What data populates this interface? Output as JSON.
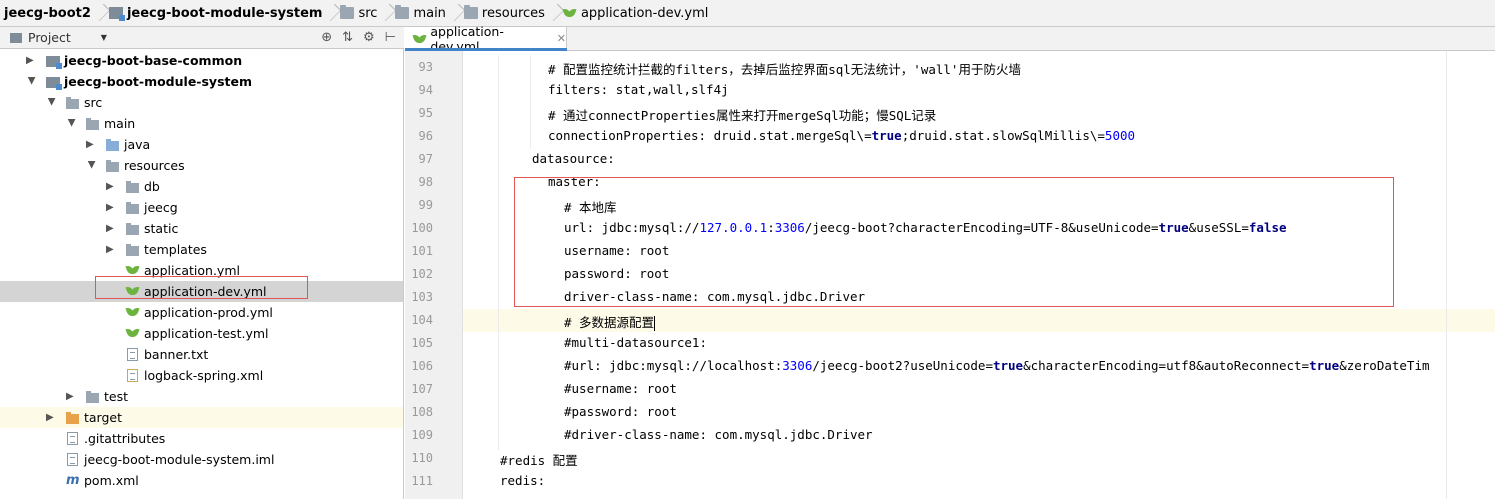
{
  "breadcrumb": [
    "jeecg-boot2",
    "jeecg-boot-module-system",
    "src",
    "main",
    "resources",
    "application-dev.yml"
  ],
  "project_panel": {
    "title": "Project",
    "tree": [
      {
        "label": "jeecg-boot-base-common"
      },
      {
        "label": "jeecg-boot-module-system"
      },
      {
        "label": "src"
      },
      {
        "label": "main"
      },
      {
        "label": "java"
      },
      {
        "label": "resources"
      },
      {
        "label": "db"
      },
      {
        "label": "jeecg"
      },
      {
        "label": "static"
      },
      {
        "label": "templates"
      },
      {
        "label": "application.yml"
      },
      {
        "label": "application-dev.yml"
      },
      {
        "label": "application-prod.yml"
      },
      {
        "label": "application-test.yml"
      },
      {
        "label": "banner.txt"
      },
      {
        "label": "logback-spring.xml"
      },
      {
        "label": "test"
      },
      {
        "label": "target"
      },
      {
        "label": ".gitattributes"
      },
      {
        "label": "jeecg-boot-module-system.iml"
      },
      {
        "label": "pom.xml"
      }
    ]
  },
  "editor": {
    "tab_label": "application-dev.yml",
    "line_numbers": [
      "93",
      "94",
      "95",
      "96",
      "97",
      "98",
      "99",
      "100",
      "101",
      "102",
      "103",
      "104",
      "105",
      "106",
      "107",
      "108",
      "109",
      "110",
      "111"
    ],
    "lines": {
      "l93": "# 配置监控统计拦截的filters，去掉后监控界面sql无法统计，'wall'用于防火墙",
      "l94": "filters: stat,wall,slf4j",
      "l95": "# 通过connectProperties属性来打开mergeSql功能；慢SQL记录",
      "l96a": "connectionProperties: druid.stat.mergeSql\\=",
      "l96b": "true",
      "l96c": ";druid.stat.slowSqlMillis\\=",
      "l96d": "5000",
      "l97": "datasource:",
      "l98": "master:",
      "l99": "# 本地库",
      "l100a": "url: jdbc:mysql://",
      "l100b": "127.0.0.1",
      "l100c": ":",
      "l100d": "3306",
      "l100e": "/jeecg-boot?characterEncoding=UTF-8&useUnicode=",
      "l100f": "true",
      "l100g": "&useSSL=",
      "l100h": "false",
      "l101": "username: root",
      "l102": "password: root",
      "l103": "driver-class-name: com.mysql.jdbc.Driver",
      "l104": "# 多数据源配置",
      "l105": "#multi-datasource1:",
      "l106a": "#url: jdbc:mysql://localhost:",
      "l106b": "3306",
      "l106c": "/jeecg-boot2?useUnicode=",
      "l106d": "true",
      "l106e": "&characterEncoding=utf8&autoReconnect=",
      "l106f": "true",
      "l106g": "&zeroDateTim",
      "l107": "#username: root",
      "l108": "#password: root",
      "l109": "#driver-class-name: com.mysql.jdbc.Driver",
      "l110": "#redis 配置",
      "l111": "redis:"
    }
  }
}
